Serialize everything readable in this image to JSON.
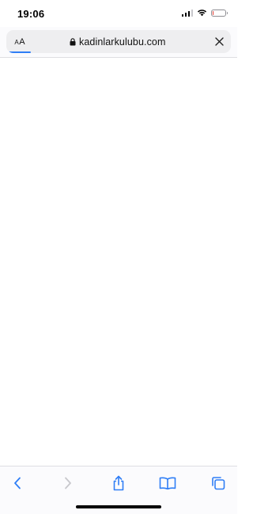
{
  "status_bar": {
    "time": "19:06",
    "icons": [
      "cellular-signal-icon",
      "wifi-icon",
      "battery-icon"
    ],
    "battery_level": 0.08,
    "battery_color": "#e5372b"
  },
  "address_bar": {
    "reader_button_label": "AA",
    "lock_icon": "lock-icon",
    "url": "kadinlarkulubu.com",
    "close_icon": "close-icon",
    "load_progress": 0.1,
    "progress_color": "#2f7ef6"
  },
  "toolbar": {
    "back_icon": "chevron-left-icon",
    "forward_icon": "chevron-right-icon",
    "share_icon": "share-icon",
    "bookmarks_icon": "book-icon",
    "tabs_icon": "tabs-icon",
    "accent_color": "#2f7ef6",
    "disabled_color": "#c7c7cc"
  }
}
